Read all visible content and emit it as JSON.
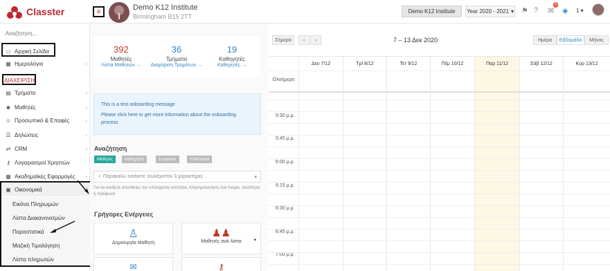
{
  "app": {
    "brand": "Classter"
  },
  "institute": {
    "name": "Demo K12 Institute",
    "address": "Birmingham B15 2TT",
    "button": "Demo K12 Institute",
    "year": "Year 2020 - 2021",
    "user_count": "1"
  },
  "badges": {
    "mail": "0"
  },
  "sidebar": {
    "search_placeholder": "Αναζήτηση...",
    "items": [
      {
        "label": "Αρχική Σελίδα",
        "icon": "laptop-icon"
      },
      {
        "label": "Ημερολόγιο",
        "icon": "calendar-icon"
      },
      {
        "label": "ΔΙΑΧΕΙΡΙΣΗ",
        "icon": ""
      },
      {
        "label": "Τμήματα",
        "icon": "grid-icon"
      },
      {
        "label": "Μαθητές",
        "icon": "users-icon"
      },
      {
        "label": "Προσωπικό & Επαφές",
        "icon": "contacts-icon"
      },
      {
        "label": "Δηλώσεις",
        "icon": "list-icon"
      },
      {
        "label": "CRM",
        "icon": "crm-icon"
      },
      {
        "label": "Λογαριασμοί Χρηστών",
        "icon": "key-icon"
      },
      {
        "label": "Ακαδημαϊκές Εφαρμογές",
        "icon": "apps-icon"
      },
      {
        "label": "Οικονομικά",
        "icon": "wallet-icon"
      }
    ],
    "sub_items": [
      "Εικόνα Πληρωμών",
      "Λίστα Διακανονισμών",
      "Παραστατικά",
      "Μαζική Τιμολόγηση",
      "Λίστα πληρωτών"
    ]
  },
  "stats": [
    {
      "value": "392",
      "label": "Μαθητές",
      "link": "Λίστα Μαθητών →",
      "color": "#c0392b"
    },
    {
      "value": "36",
      "label": "Τμήματα",
      "link": "Διαχείριση Τμημάτων →",
      "color": "#2e86c1"
    },
    {
      "value": "19",
      "label": "Καθηγητές",
      "link": "Καθηγητές →",
      "color": "#2e86c1"
    }
  ],
  "onboarding": {
    "line1": "This is a test onboarding message",
    "line2": "Please click here to get more information about the onboarding process"
  },
  "search_section": {
    "title": "Αναζήτηση",
    "tags": [
      "Μαθητές",
      "Καθηγητές",
      "Συγγενείς",
      "Υπάλληλοι"
    ],
    "select_placeholder": "Παρακαλώ εισάγετε τουλάχιστον 3 χαρακτήρες",
    "hint": "Για να ανοίξετε απευθείας την επιλεγμένη οντότητα, πληκτρολογήστε ένα όνομα, ταυτότητα ή τηλέφωνο"
  },
  "quick_actions": {
    "title": "Γρήγορες Ενέργειες",
    "cards": [
      "Δημιουργία Μαθητή",
      "Μαθητές ανά λίστα"
    ]
  },
  "calendar": {
    "today": "Σήμερα",
    "title": "7 – 13 Δεκ 2020",
    "views": [
      "Ημέρα",
      "Εβδομάδα",
      "Μήνας"
    ],
    "days": [
      "Δευ 7/12",
      "Τρί 8/12",
      "Τετ 9/12",
      "Πέμ 10/12",
      "Παρ 11/12",
      "Σάβ 12/12",
      "Κυρ 13/12"
    ],
    "allday": "Ολοήμερο",
    "times": [
      "5:30 μ.μ.",
      "5:45 μ.μ.",
      "6:00 μ.μ.",
      "6:15 μ.μ.",
      "6:30 μ.μ.",
      "6:45 μ.μ.",
      "7:00 μ.μ."
    ]
  },
  "colors": {
    "brand": "#c0272d",
    "today_column": "#fcf8e3",
    "tag": "#5cb85c",
    "tag_gray": "#bbbbbb"
  }
}
